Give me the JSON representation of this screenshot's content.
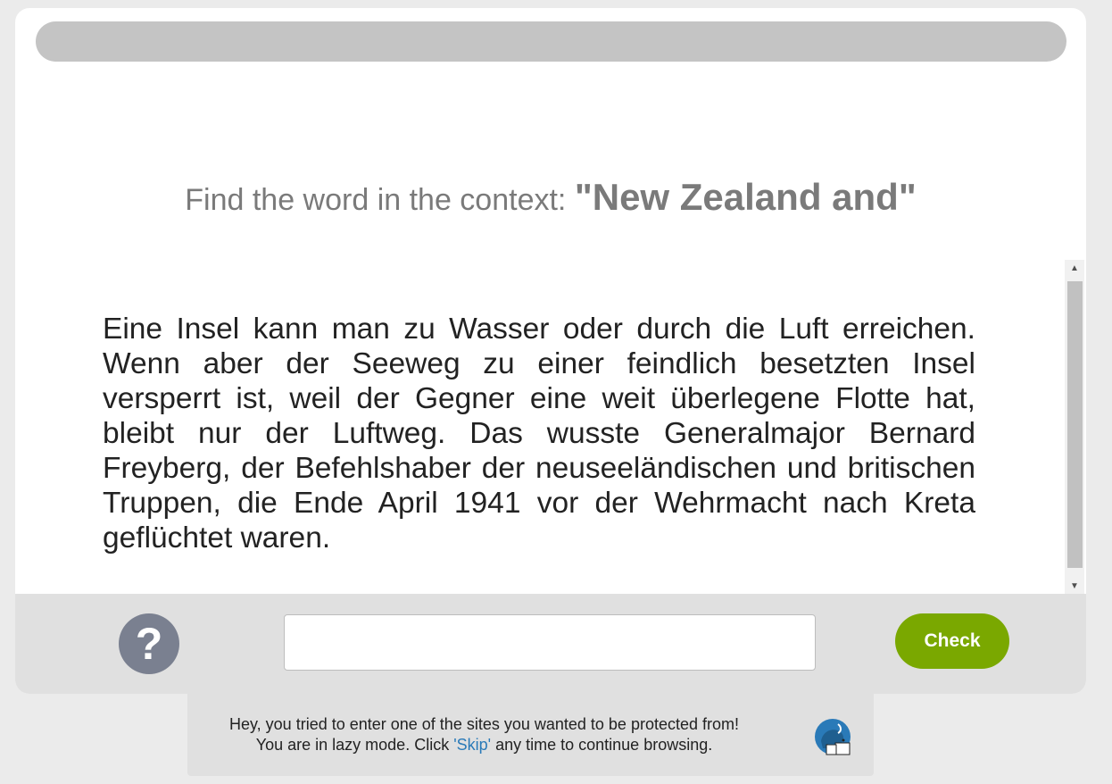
{
  "progress": {
    "fraction": 0.0
  },
  "prompt": {
    "prefix": "Find the word in the context: ",
    "phrase": "\"New Zealand and\""
  },
  "context": {
    "text": "Eine Insel kann man zu Wasser oder durch die Luft erreichen. Wenn aber der Seeweg zu einer feindlich besetzten Insel versperrt ist, weil der Gegner eine weit überlegene Flotte hat, bleibt nur der Luftweg. Das wusste Generalmajor Bernard Freyberg, der Befehlshaber der neuseeländischen und britischen Truppen, die Ende April 1941 vor der Wehrmacht nach Kreta geflüchtet waren."
  },
  "scrollbar": {
    "up_icon": "triangle-up-icon",
    "down_icon": "triangle-down-icon"
  },
  "answer": {
    "help_label": "?",
    "input_value": "",
    "input_placeholder": "",
    "check_label": "Check"
  },
  "notice": {
    "line1": "Hey, you tried to enter one of the sites you wanted to be protected from!",
    "line2_before": "You are in lazy mode. Click ",
    "skip_label": "'Skip'",
    "line2_after": " any time to continue browsing.",
    "icon": "elephant-logo-icon"
  },
  "colors": {
    "accent_green": "#7aa800",
    "help_gray": "#7a8090",
    "link_blue": "#2a7ab8",
    "progress_track": "#c4c4c4"
  }
}
